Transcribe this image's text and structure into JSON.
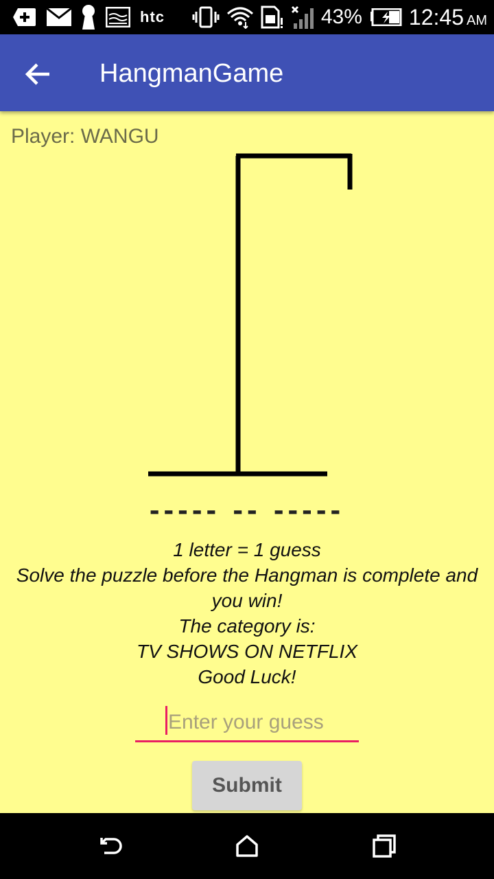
{
  "status_bar": {
    "carrier": "htc",
    "battery_percent": "43%",
    "time": "12:45",
    "ampm": "AM",
    "icons": [
      "add-icon",
      "mail-icon",
      "keyhole-icon",
      "image-icon",
      "vibrate-icon",
      "wifi-icon",
      "sim-icon",
      "signal-icon",
      "battery-charging-icon"
    ]
  },
  "app_bar": {
    "title": "HangmanGame",
    "back_icon": "arrow-back-icon",
    "color": "#3f51b5"
  },
  "game": {
    "player_label": "Player: WANGU",
    "word_mask": "----- -- -----",
    "instructions": [
      "1 letter = 1 guess",
      "Solve the puzzle before the Hangman is complete and",
      "you win!",
      "The category is:",
      "TV SHOWS ON NETFLIX",
      "Good Luck!"
    ],
    "guess_placeholder": "Enter your guess",
    "guess_value": "",
    "submit_label": "Submit",
    "background": "#fffd8f",
    "accent": "#e91e63"
  },
  "nav_bar": {
    "icons": [
      "back-nav-icon",
      "home-icon",
      "recent-apps-icon"
    ]
  }
}
